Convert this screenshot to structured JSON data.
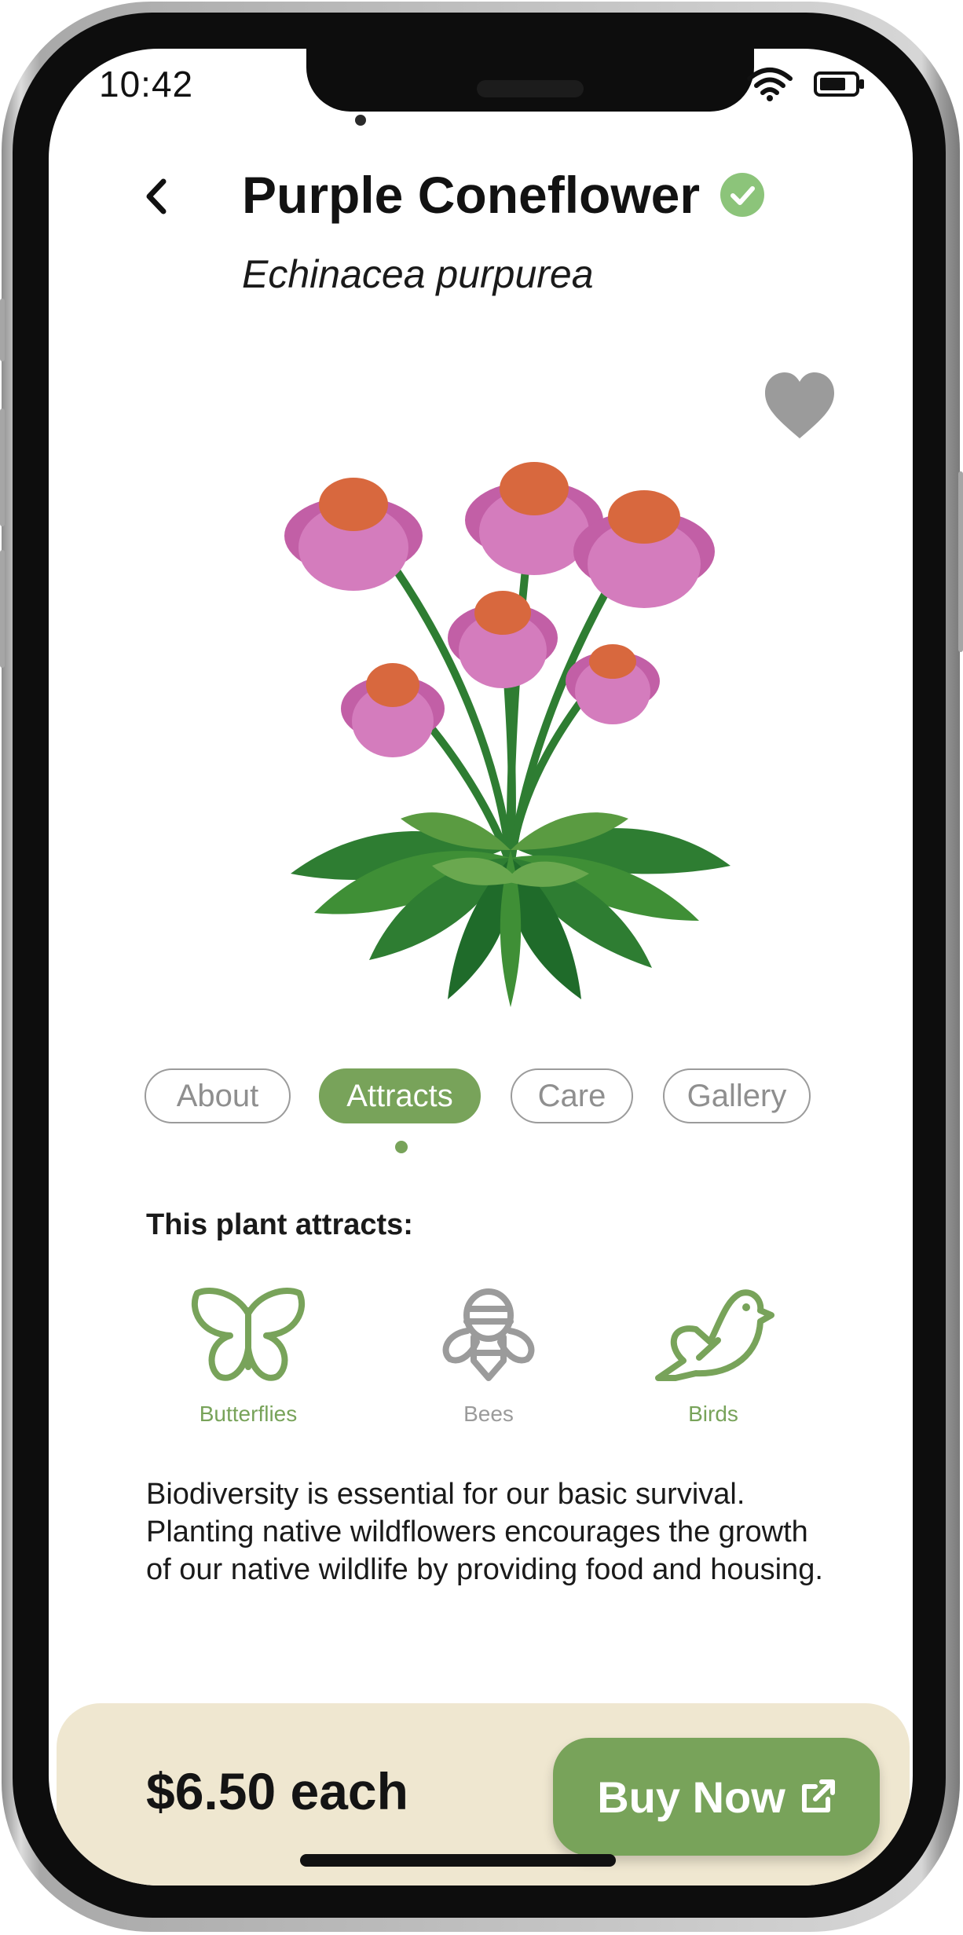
{
  "status_bar": {
    "time": "10:42",
    "icons": [
      "wifi-icon",
      "battery-icon"
    ]
  },
  "header": {
    "plant_name": "Purple Coneflower",
    "scientific_name": "Echinacea purpurea",
    "verified": true,
    "back_icon": "chevron-left-icon",
    "favorite_icon": "heart-icon",
    "favorited": false
  },
  "tabs": [
    {
      "label": "About",
      "active": false
    },
    {
      "label": "Attracts",
      "active": true
    },
    {
      "label": "Care",
      "active": false
    },
    {
      "label": "Gallery",
      "active": false
    }
  ],
  "attracts": {
    "heading": "This plant attracts:",
    "items": [
      {
        "label": "Butterflies",
        "icon": "butterfly-icon",
        "active": true
      },
      {
        "label": "Bees",
        "icon": "bee-icon",
        "active": false
      },
      {
        "label": "Birds",
        "icon": "bird-icon",
        "active": true
      }
    ],
    "description": "Biodiversity is essential for our basic survival. Planting native wildflowers encourages the growth of our native wildlife by providing food and housing."
  },
  "purchase": {
    "price": "$6.50 each",
    "buy_label": "Buy Now",
    "buy_icon": "external-link-icon"
  },
  "colors": {
    "accent_green": "#78a35a",
    "inactive_gray": "#9b9b9b",
    "footer_bg": "#efe7d0",
    "verified_green": "#8cc47a"
  }
}
